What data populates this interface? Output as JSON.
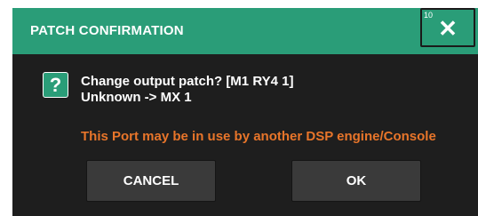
{
  "dialog": {
    "title": "PATCH CONFIRMATION",
    "close_number": "10",
    "close_glyph": "✕",
    "question_glyph": "?",
    "message_line1": "Change output patch? [M1 RY4 1]",
    "message_line2": "Unknown -> MX 1",
    "warning": "This Port may be in use by another DSP engine/Console",
    "cancel_label": "CANCEL",
    "ok_label": "OK"
  },
  "colors": {
    "title_bar": "#2a9d78",
    "background": "#1e1e1e",
    "button": "#3a3a3a",
    "warning_text": "#e8752a"
  },
  "icons": {
    "close": "close-icon",
    "question": "question-icon"
  }
}
